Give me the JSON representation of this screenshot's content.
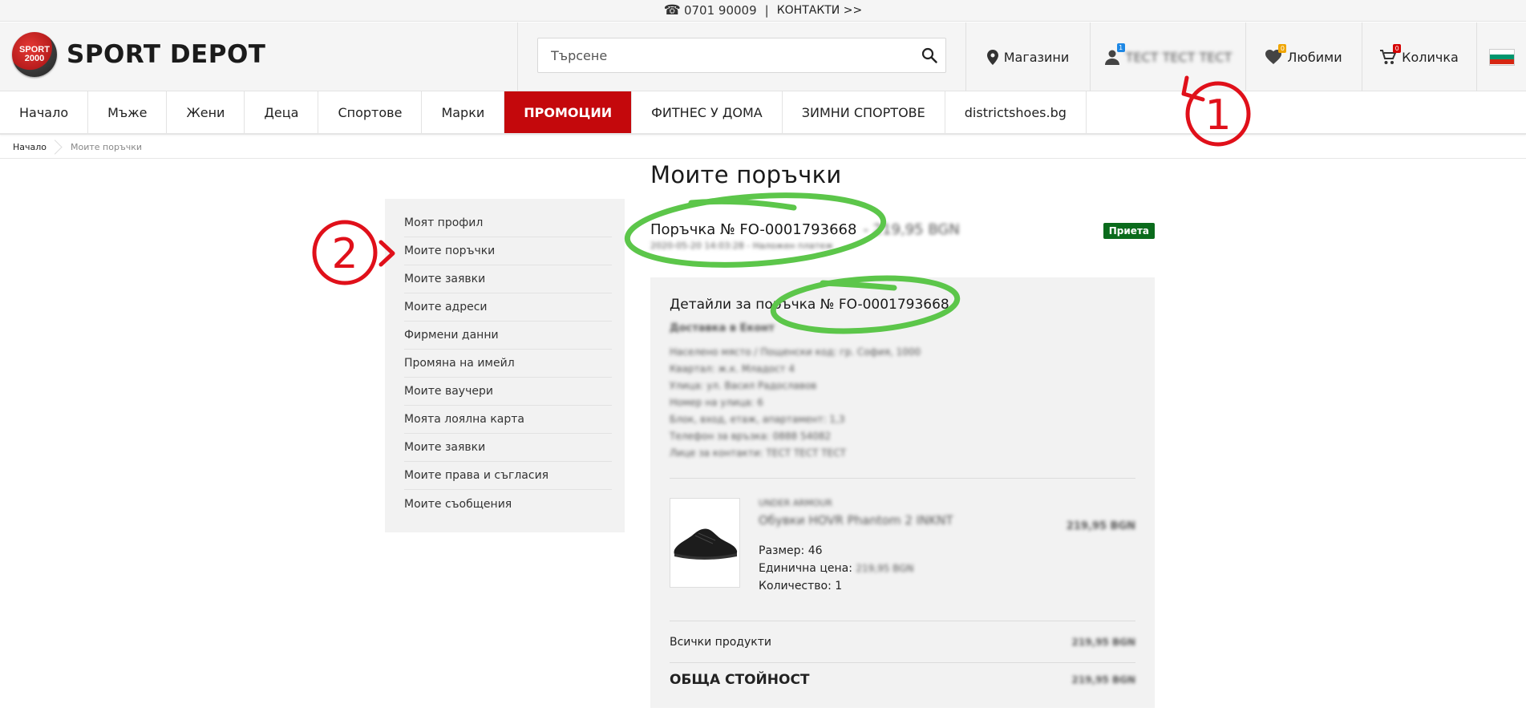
{
  "topbar": {
    "phone": "0701 90009",
    "separator": "|",
    "contacts": "КОНТАКТИ >>"
  },
  "header": {
    "logo_badge_line1": "SPORT",
    "logo_badge_line2": "2000",
    "logo_text": "SPORT DEPOT",
    "search_placeholder": "Търсене",
    "stores_label": "Магазини",
    "user_name": "ТЕСТ ТЕСТ ТЕСТ",
    "user_badge": "1",
    "favorites_label": "Любими",
    "favorites_badge": "0",
    "cart_label": "Количка",
    "cart_badge": "0"
  },
  "menu": [
    "Начало",
    "Мъже",
    "Жени",
    "Деца",
    "Спортове",
    "Марки",
    "ПРОМОЦИИ",
    "ФИТНЕС У ДОМА",
    "ЗИМНИ СПОРТОВЕ",
    "districtshoes.bg"
  ],
  "breadcrumb": {
    "home": "Начало",
    "current": "Моите поръчки"
  },
  "page_title": "Моите поръчки",
  "sidebar": [
    "Моят профил",
    "Моите поръчки",
    "Моите заявки",
    "Моите адреси",
    "Фирмени данни",
    "Промяна на имейл",
    "Моите ваучери",
    "Моята лоялна карта",
    "Моите заявки",
    "Моите права и съгласия",
    "Моите съобщения"
  ],
  "order": {
    "title": "Поръчка № FO-0001793668",
    "price": "- 219,95 BGN",
    "subline": "2020-05-20 14:03:28 - Наложен платеж",
    "status": "Приета"
  },
  "details": {
    "title": "Детайли за поръчка № FO-0001793668",
    "delivery": "Доставка в Еконт",
    "address_lines": [
      "Населено място / Пощенски код: гр. София, 1000",
      "Квартал: ж.к. Младост 4",
      "Улица: ул. Васил Радославов",
      "Номер на улица: 6",
      "Блок, вход, етаж, апартамент: 1,3",
      "Телефон за връзка: 0888 54082",
      "Лице за контакти: ТЕСТ ТЕСТ ТЕСТ"
    ],
    "product": {
      "brand": "UNDER ARMOUR",
      "name": "Обувки HOVR Phantom 2 INKNT",
      "price": "219,95 BGN",
      "size_label": "Размер: 46",
      "unit_price_label": "Единична цена:",
      "unit_price": "219,95 BGN",
      "quantity_label": "Количество: 1"
    },
    "all_products_label": "Всички продукти",
    "all_products_amount": "219,95 BGN",
    "total_label": "ОБЩА СТОЙНОСТ",
    "total_amount": "219,95 BGN"
  },
  "annotations": {
    "marker_1": "1",
    "marker_2": "2"
  },
  "colors": {
    "accent_red": "#c4080c",
    "status_green": "#0a6b1c",
    "annotation_green": "#5cc64a",
    "annotation_red": "#e0101a"
  }
}
